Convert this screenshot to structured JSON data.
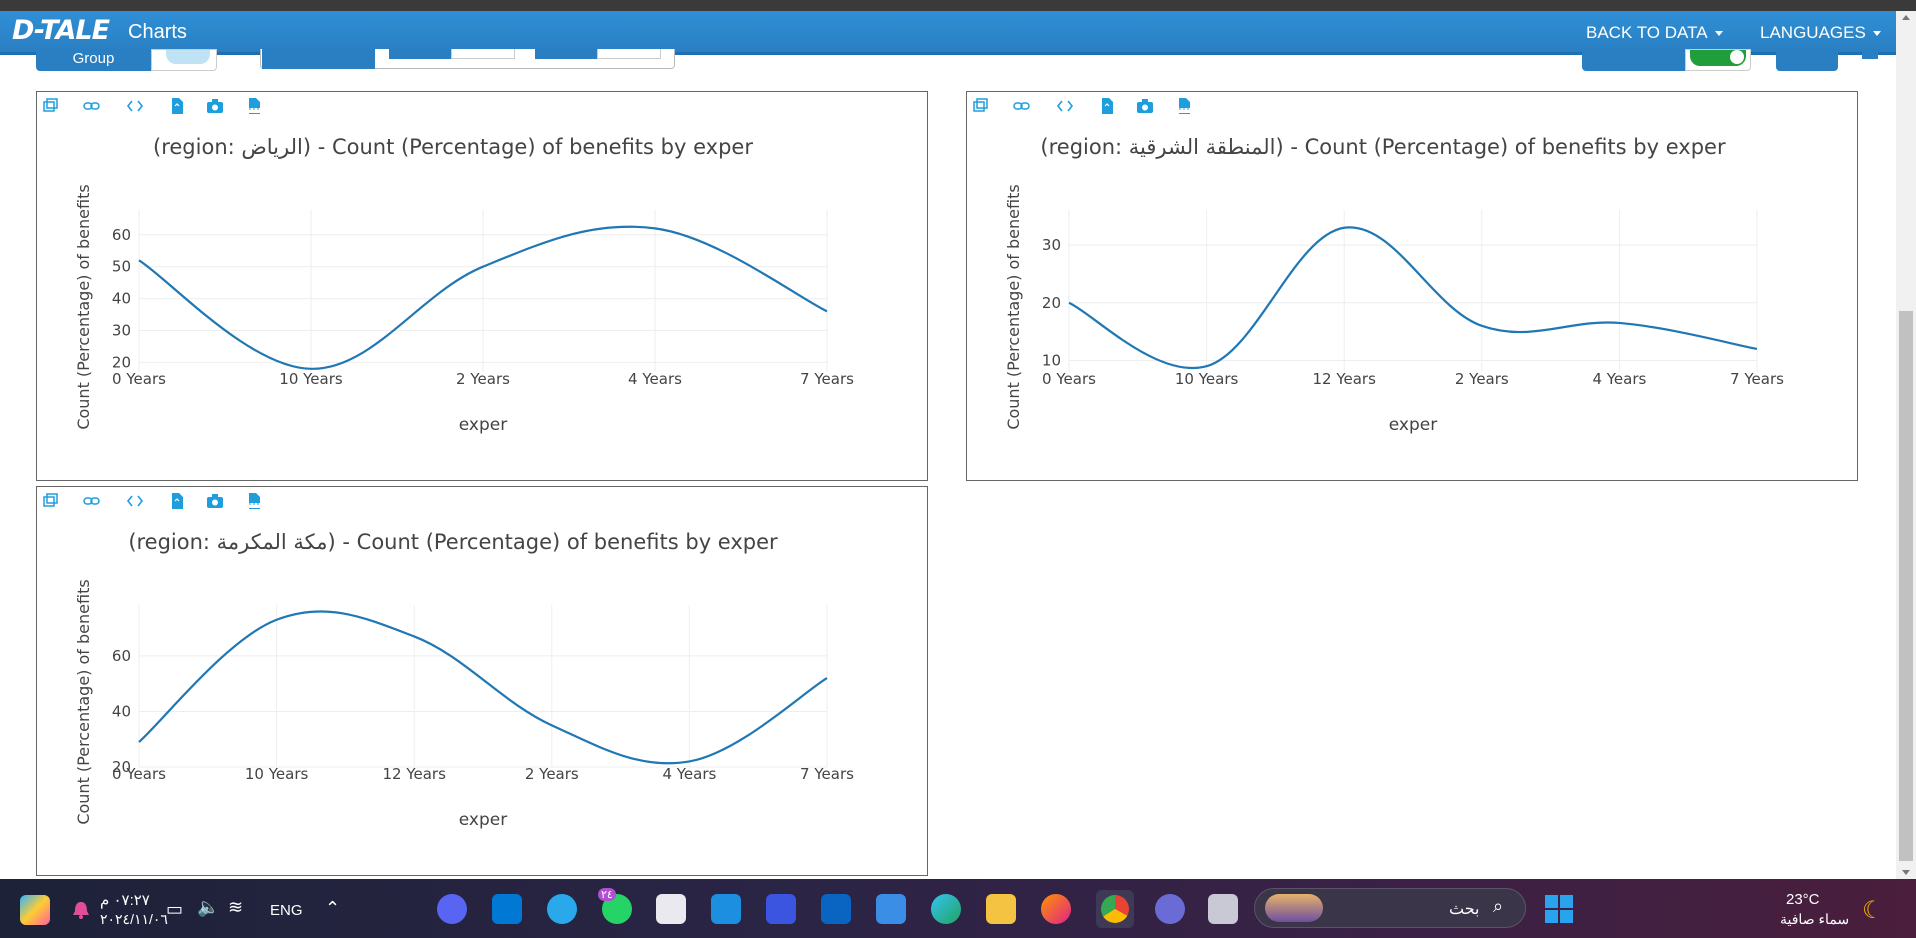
{
  "navbar": {
    "brand": "D-TALE",
    "subtitle": "Charts",
    "back_to_data": "BACK TO DATA",
    "languages": "LANGUAGES"
  },
  "controls": {
    "group_label": "Group"
  },
  "colors": {
    "navbar": "#2a7fc2",
    "line": "#1f77b4",
    "icon": "#1f9ede",
    "toggle_on": "#1f9e3a"
  },
  "toolbar_icons": [
    "popup-icon",
    "link-icon",
    "code-icon",
    "export-icon",
    "camera-icon",
    "csv-icon"
  ],
  "chart_data": [
    {
      "type": "line",
      "title": "(region: الرياض) - Count (Percentage) of benefits by exper",
      "xlabel": "exper",
      "ylabel": "Count (Percentage) of benefits",
      "categories": [
        "0 Years",
        "10 Years",
        "2 Years",
        "4 Years",
        "7 Years"
      ],
      "values": [
        52,
        18,
        50,
        62,
        36
      ],
      "yticks": [
        20,
        30,
        40,
        50,
        60
      ],
      "ylim": [
        17,
        64
      ]
    },
    {
      "type": "line",
      "title": "(region: المنطقة الشرقية) - Count (Percentage) of benefits by exper",
      "xlabel": "exper",
      "ylabel": "Count (Percentage) of benefits",
      "categories": [
        "0 Years",
        "10 Years",
        "12 Years",
        "2 Years",
        "4 Years",
        "7 Years"
      ],
      "values": [
        20,
        9,
        33,
        16,
        16.5,
        12
      ],
      "yticks": [
        10,
        20,
        30
      ],
      "ylim": [
        8,
        34
      ]
    },
    {
      "type": "line",
      "title": "(region: مكة المكرمة) - Count (Percentage) of benefits by exper",
      "xlabel": "exper",
      "ylabel": "Count (Percentage) of benefits",
      "categories": [
        "0 Years",
        "10 Years",
        "12 Years",
        "2 Years",
        "4 Years",
        "7 Years"
      ],
      "values": [
        29,
        73,
        67,
        35,
        22,
        52
      ],
      "yticks": [
        20,
        40,
        60
      ],
      "ylim": [
        20,
        74
      ]
    }
  ],
  "taskbar": {
    "time": "٠٧:٢٧ م",
    "date": "٢٠٢٤/١١/٠٦",
    "lang": "ENG",
    "search_placeholder": "بحث",
    "temperature": "23°C",
    "weather": "سماء صافية",
    "badge": "٢٤"
  }
}
